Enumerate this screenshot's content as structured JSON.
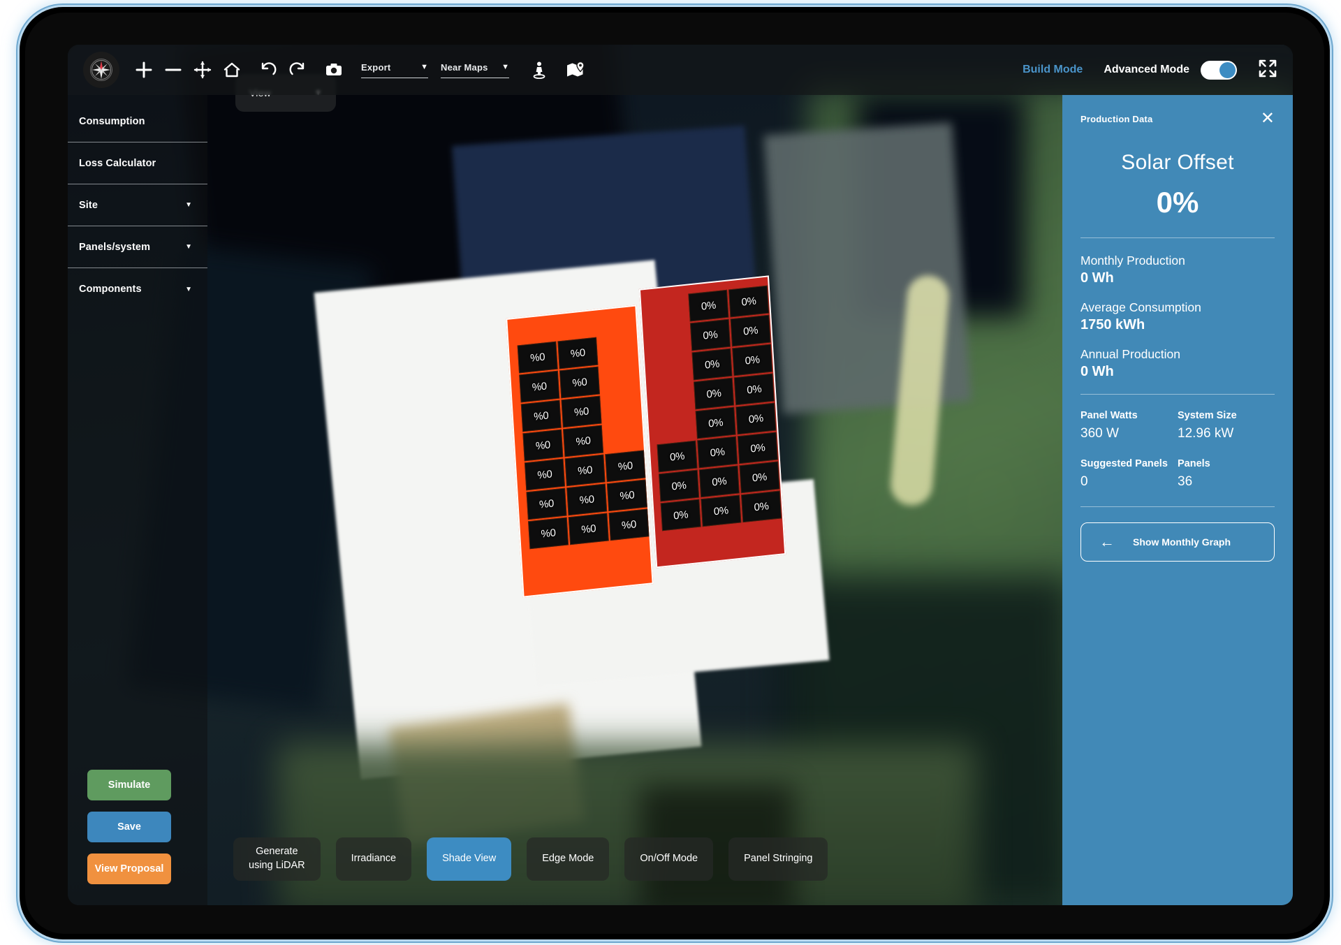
{
  "toolbar": {
    "compass_icon": "compass-icon",
    "tools": [
      {
        "name": "zoom-in-icon",
        "glyph": "+"
      },
      {
        "name": "zoom-out-icon",
        "glyph": "−"
      },
      {
        "name": "pan-icon",
        "glyph": "move"
      },
      {
        "name": "home-icon",
        "glyph": "home"
      },
      {
        "name": "undo-icon",
        "glyph": "undo"
      },
      {
        "name": "redo-icon",
        "glyph": "redo"
      },
      {
        "name": "camera-icon",
        "glyph": "camera"
      }
    ],
    "export_dropdown": "Export",
    "maps_dropdown": "Near Maps",
    "street_view_icon": "street-view-pegman-icon",
    "map_layer_icon": "map-location-icon",
    "build_mode_label": "Build Mode",
    "advanced_mode_label": "Advanced Mode",
    "advanced_mode_on": true,
    "fullscreen_icon": "fullscreen-expand-icon",
    "caret": "▼"
  },
  "sidebar": {
    "items": [
      {
        "label": "Consumption",
        "has_caret": false
      },
      {
        "label": "Loss Calculator",
        "has_caret": false
      },
      {
        "label": "Site",
        "has_caret": true
      },
      {
        "label": "Panels/system",
        "has_caret": true
      },
      {
        "label": "Components",
        "has_caret": true
      }
    ],
    "actions": {
      "simulate": "Simulate",
      "save": "Save",
      "view_proposal": "View Proposal"
    }
  },
  "map": {
    "view_dropdown": "View",
    "solar_array": {
      "left_face_color": "#ff4a0f",
      "right_face_color": "#c3261f",
      "left_panel_labels": [
        "%0",
        "%0",
        "",
        "%0",
        "%0",
        "",
        "%0",
        "%0",
        "",
        "%0",
        "%0",
        "",
        "%0",
        "%0",
        "%0",
        "%0",
        "%0",
        "%0",
        "%0",
        "%0",
        "%0"
      ],
      "right_panel_labels": [
        "",
        "0%",
        "0%",
        "",
        "0%",
        "0%",
        "",
        "0%",
        "0%",
        "",
        "0%",
        "0%",
        "",
        "0%",
        "0%",
        "0%",
        "0%",
        "0%",
        "0%",
        "0%",
        "0%",
        "0%",
        "0%",
        "0%"
      ]
    }
  },
  "bottom_bar": {
    "buttons": [
      {
        "label": "Generate\nusing LiDAR",
        "active": false
      },
      {
        "label": "Irradiance",
        "active": false
      },
      {
        "label": "Shade View",
        "active": true
      },
      {
        "label": "Edge Mode",
        "active": false
      },
      {
        "label": "On/Off Mode",
        "active": false
      },
      {
        "label": "Panel Stringing",
        "active": false
      }
    ],
    "collapse_handle": "◀"
  },
  "production_panel": {
    "title": "Production Data",
    "close_icon": "✕",
    "solar_offset_title": "Solar Offset",
    "solar_offset_value": "0%",
    "stats": [
      {
        "label": "Monthly Production",
        "value": "0 Wh"
      },
      {
        "label": "Average Consumption",
        "value": "1750 kWh"
      },
      {
        "label": "Annual Production",
        "value": "0 Wh"
      }
    ],
    "grid_stats": [
      {
        "label": "Panel Watts",
        "value": "360 W"
      },
      {
        "label": "System Size",
        "value": "12.96 kW"
      },
      {
        "label": "Suggested Panels",
        "value": "0"
      },
      {
        "label": "Panels",
        "value": "36"
      }
    ],
    "show_graph_label": "Show Monthly Graph",
    "back_arrow_icon": "←",
    "background_color": "#4189b7"
  }
}
